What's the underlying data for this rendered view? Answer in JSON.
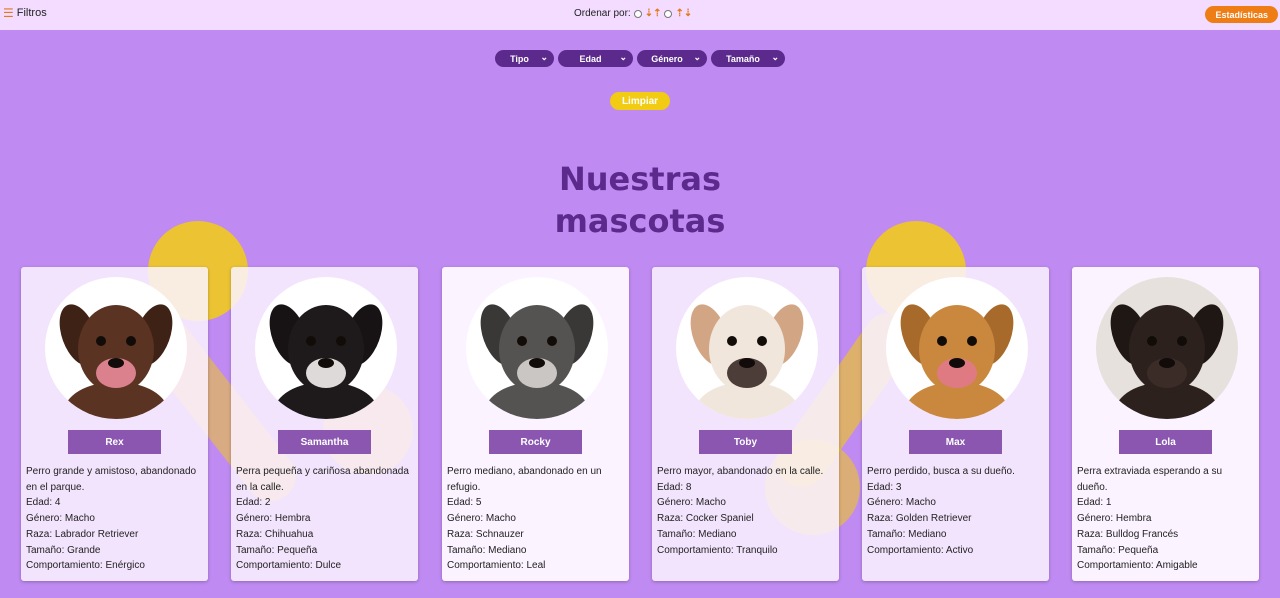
{
  "topbar": {
    "filters_label": "Filtros",
    "sort_label": "Ordenar por:",
    "sort_option_1": "⇣⇡",
    "sort_option_2": "⇡⇣",
    "stats_label": "Estadísticas"
  },
  "filters": {
    "dropdowns": [
      {
        "label": "Tipo"
      },
      {
        "label": "Edad"
      },
      {
        "label": "Género"
      },
      {
        "label": "Tamaño"
      }
    ],
    "clear_label": "Limpiar"
  },
  "page_title_line1": "Nuestras",
  "page_title_line2": "mascotas",
  "labels": {
    "age": "Edad: ",
    "gender": "Género: ",
    "breed": "Raza: ",
    "size": "Tamaño: ",
    "behavior": "Comportamiento: "
  },
  "pets": [
    {
      "name": "Rex",
      "desc": "Perro grande y amistoso, abandonado en el parque.",
      "age": "Edad: 4",
      "gender": "Género: Macho",
      "breed": "Raza: Labrador Retriever",
      "size": "Tamaño: Grande",
      "behavior": "Comportamiento: Enérgico",
      "fur": "#5a3322",
      "ear": "#3f2216",
      "tongue": "#e88a99"
    },
    {
      "name": "Samantha",
      "desc": "Perra pequeña y cariñosa abandonada en la calle.",
      "age": "Edad: 2",
      "gender": "Género: Hembra",
      "breed": "Raza: Chihuahua",
      "size": "Tamaño: Pequeña",
      "behavior": "Comportamiento: Dulce",
      "fur": "#1e1a1c",
      "ear": "#171214",
      "tongue": "#f2f0ee"
    },
    {
      "name": "Rocky",
      "desc": "Perro mediano, abandonado en un refugio.",
      "age": "Edad: 5",
      "gender": "Género: Macho",
      "breed": "Raza: Schnauzer",
      "size": "Tamaño: Mediano",
      "behavior": "Comportamiento: Leal",
      "fur": "#555352",
      "ear": "#3a3837",
      "tongue": "#d7d3cf"
    },
    {
      "name": "Toby",
      "desc": "Perro mayor, abandonado en la calle.",
      "age": "Edad: 8",
      "gender": "Género: Macho",
      "breed": "Raza: Cocker Spaniel",
      "size": "Tamaño: Mediano",
      "behavior": "Comportamiento: Tranquilo",
      "fur": "#f1e6dc",
      "ear": "#d2a684",
      "tongue": "#3b2a26"
    },
    {
      "name": "Max",
      "desc": "Perro perdido, busca a su dueño.",
      "age": "Edad: 3",
      "gender": "Género: Macho",
      "breed": "Raza: Golden Retriever",
      "size": "Tamaño: Mediano",
      "behavior": "Comportamiento: Activo",
      "fur": "#c9883d",
      "ear": "#a86a2b",
      "tongue": "#e27989"
    },
    {
      "name": "Lola",
      "desc": "Perra extraviada esperando a su dueño.",
      "age": "Edad: 1",
      "gender": "Género: Hembra",
      "breed": "Raza: Bulldog Francés",
      "size": "Tamaño: Pequeña",
      "behavior": "Comportamiento: Amigable",
      "fur": "#2c211d",
      "ear": "#1f1714",
      "tongue": "#3d2e29"
    }
  ]
}
